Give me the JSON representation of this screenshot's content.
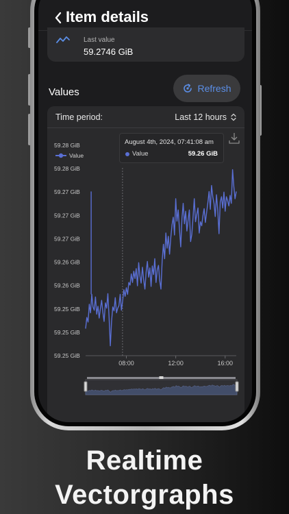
{
  "header": {
    "title": "Item details"
  },
  "last_value": {
    "label": "Last value",
    "value": "59.2746 GiB"
  },
  "values_section": {
    "label": "Values",
    "refresh_label": "Refresh"
  },
  "time_period": {
    "label": "Time period:",
    "value": "Last 12 hours"
  },
  "legend": {
    "label": "Value"
  },
  "tooltip": {
    "date": "August 4th, 2024, 07:41:08 am",
    "name": "Value",
    "value": "59.26 GiB"
  },
  "promo": {
    "line1": "Realtime",
    "line2": "Vectorgraphs"
  },
  "colors": {
    "series": "#5a6fd4",
    "accent": "#5b8ee6",
    "background": "#1c1c1e"
  },
  "chart_data": {
    "type": "line",
    "y_tick_labels": [
      "59.28 GiB",
      "59.28 GiB",
      "59.27 GiB",
      "59.27 GiB",
      "59.27 GiB",
      "59.26 GiB",
      "59.26 GiB",
      "59.25 GiB",
      "59.25 GiB",
      "59.25 GiB"
    ],
    "x_tick_labels": [
      "08:00",
      "12:00",
      "16:00"
    ],
    "x_ticks_hours": [
      8,
      12,
      16
    ],
    "x_range_hours": [
      4.7,
      16.9
    ],
    "ylim": [
      59.2497,
      59.2816
    ],
    "series": [
      {
        "name": "Value",
        "points": [
          [
            4.7,
            59.2538
          ],
          [
            4.8,
            59.2555
          ],
          [
            4.9,
            59.2548
          ],
          [
            5.0,
            59.2575
          ],
          [
            5.1,
            59.2562
          ],
          [
            5.2,
            59.259
          ],
          [
            5.3,
            59.2571
          ],
          [
            5.4,
            59.2566
          ],
          [
            5.5,
            59.2586
          ],
          [
            5.6,
            59.256
          ],
          [
            5.7,
            59.2572
          ],
          [
            5.8,
            59.2554
          ],
          [
            5.9,
            59.2568
          ],
          [
            6.0,
            59.2581
          ],
          [
            6.1,
            59.2563
          ],
          [
            6.2,
            59.2549
          ],
          [
            6.3,
            59.2577
          ],
          [
            6.4,
            59.2569
          ],
          [
            6.5,
            59.2591
          ],
          [
            6.6,
            59.2555
          ],
          [
            6.7,
            59.2512
          ],
          [
            6.8,
            59.2549
          ],
          [
            6.9,
            59.2571
          ],
          [
            7.0,
            59.2565
          ],
          [
            7.1,
            59.2585
          ],
          [
            7.2,
            59.2562
          ],
          [
            7.3,
            59.2569
          ],
          [
            7.4,
            59.2573
          ],
          [
            7.5,
            59.259
          ],
          [
            7.6,
            59.2566
          ],
          [
            7.7,
            59.258
          ],
          [
            7.8,
            59.2597
          ],
          [
            7.9,
            59.2587
          ],
          [
            8.0,
            59.26
          ],
          [
            8.1,
            59.259
          ],
          [
            8.2,
            59.2608
          ],
          [
            8.3,
            59.2604
          ],
          [
            8.4,
            59.2621
          ],
          [
            8.5,
            59.2608
          ],
          [
            8.6,
            59.2625
          ],
          [
            8.7,
            59.2614
          ],
          [
            8.8,
            59.2629
          ],
          [
            8.9,
            59.2603
          ],
          [
            9.0,
            59.2638
          ],
          [
            9.1,
            59.2618
          ],
          [
            9.2,
            59.2607
          ],
          [
            9.3,
            59.2631
          ],
          [
            9.4,
            59.2612
          ],
          [
            9.5,
            59.2598
          ],
          [
            9.6,
            59.2624
          ],
          [
            9.7,
            59.264
          ],
          [
            9.8,
            59.2616
          ],
          [
            9.9,
            59.263
          ],
          [
            10.0,
            59.2602
          ],
          [
            10.1,
            59.2633
          ],
          [
            10.2,
            59.262
          ],
          [
            10.3,
            59.2644
          ],
          [
            10.4,
            59.2608
          ],
          [
            10.5,
            59.2627
          ],
          [
            10.6,
            59.2634
          ],
          [
            10.7,
            59.2611
          ],
          [
            10.8,
            59.2598
          ],
          [
            10.9,
            59.2641
          ],
          [
            11.0,
            59.2666
          ],
          [
            11.1,
            59.2644
          ],
          [
            11.2,
            59.2683
          ],
          [
            11.3,
            59.266
          ],
          [
            11.4,
            59.2678
          ],
          [
            11.5,
            59.2651
          ],
          [
            11.6,
            59.2676
          ],
          [
            11.7,
            59.2695
          ],
          [
            11.8,
            59.2707
          ],
          [
            11.9,
            59.268
          ],
          [
            12.0,
            59.2735
          ],
          [
            12.1,
            59.2701
          ],
          [
            12.2,
            59.2718
          ],
          [
            12.3,
            59.269
          ],
          [
            12.4,
            59.2662
          ],
          [
            12.5,
            59.2705
          ],
          [
            12.6,
            59.2728
          ],
          [
            12.7,
            59.2697
          ],
          [
            12.8,
            59.2716
          ],
          [
            12.9,
            59.2686
          ],
          [
            13.0,
            59.2703
          ],
          [
            13.1,
            59.2718
          ],
          [
            13.2,
            59.267
          ],
          [
            13.3,
            59.2681
          ],
          [
            13.4,
            59.2707
          ],
          [
            13.5,
            59.2735
          ],
          [
            13.6,
            59.27
          ],
          [
            13.7,
            59.2711
          ],
          [
            13.8,
            59.2721
          ],
          [
            13.9,
            59.2683
          ],
          [
            14.0,
            59.27
          ],
          [
            14.1,
            59.2694
          ],
          [
            14.2,
            59.2709
          ],
          [
            14.3,
            59.272
          ],
          [
            14.4,
            59.2699
          ],
          [
            14.5,
            59.2714
          ],
          [
            14.6,
            59.2729
          ],
          [
            14.7,
            59.2746
          ],
          [
            14.8,
            59.2719
          ],
          [
            14.9,
            59.2755
          ],
          [
            15.0,
            59.2738
          ],
          [
            15.1,
            59.2728
          ],
          [
            15.2,
            59.2708
          ],
          [
            15.3,
            59.2741
          ],
          [
            15.4,
            59.2717
          ],
          [
            15.5,
            59.2682
          ],
          [
            15.6,
            59.273
          ],
          [
            15.7,
            59.2738
          ],
          [
            15.8,
            59.2721
          ],
          [
            15.9,
            59.2745
          ],
          [
            16.0,
            59.2716
          ],
          [
            16.1,
            59.2738
          ],
          [
            16.2,
            59.2732
          ],
          [
            16.3,
            59.2724
          ],
          [
            16.4,
            59.274
          ],
          [
            16.5,
            59.2728
          ],
          [
            16.6,
            59.2779
          ],
          [
            16.7,
            59.2754
          ],
          [
            16.8,
            59.2735
          ],
          [
            16.9,
            59.2746
          ]
        ]
      }
    ],
    "spikes": [
      [
        5.15,
        59.2746
      ],
      [
        6.65,
        59.2512
      ]
    ],
    "tooltip_x_hours": 7.69,
    "grid": false,
    "legend_position": "top-left"
  }
}
